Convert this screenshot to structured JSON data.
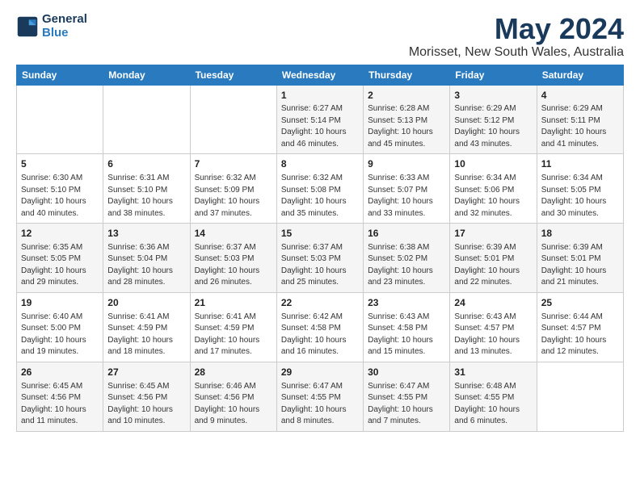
{
  "header": {
    "logo_line1": "General",
    "logo_line2": "Blue",
    "title": "May 2024",
    "subtitle": "Morisset, New South Wales, Australia"
  },
  "days_of_week": [
    "Sunday",
    "Monday",
    "Tuesday",
    "Wednesday",
    "Thursday",
    "Friday",
    "Saturday"
  ],
  "weeks": [
    [
      {
        "day": "",
        "sunrise": "",
        "sunset": "",
        "daylight": ""
      },
      {
        "day": "",
        "sunrise": "",
        "sunset": "",
        "daylight": ""
      },
      {
        "day": "",
        "sunrise": "",
        "sunset": "",
        "daylight": ""
      },
      {
        "day": "1",
        "sunrise": "Sunrise: 6:27 AM",
        "sunset": "Sunset: 5:14 PM",
        "daylight": "Daylight: 10 hours and 46 minutes."
      },
      {
        "day": "2",
        "sunrise": "Sunrise: 6:28 AM",
        "sunset": "Sunset: 5:13 PM",
        "daylight": "Daylight: 10 hours and 45 minutes."
      },
      {
        "day": "3",
        "sunrise": "Sunrise: 6:29 AM",
        "sunset": "Sunset: 5:12 PM",
        "daylight": "Daylight: 10 hours and 43 minutes."
      },
      {
        "day": "4",
        "sunrise": "Sunrise: 6:29 AM",
        "sunset": "Sunset: 5:11 PM",
        "daylight": "Daylight: 10 hours and 41 minutes."
      }
    ],
    [
      {
        "day": "5",
        "sunrise": "Sunrise: 6:30 AM",
        "sunset": "Sunset: 5:10 PM",
        "daylight": "Daylight: 10 hours and 40 minutes."
      },
      {
        "day": "6",
        "sunrise": "Sunrise: 6:31 AM",
        "sunset": "Sunset: 5:10 PM",
        "daylight": "Daylight: 10 hours and 38 minutes."
      },
      {
        "day": "7",
        "sunrise": "Sunrise: 6:32 AM",
        "sunset": "Sunset: 5:09 PM",
        "daylight": "Daylight: 10 hours and 37 minutes."
      },
      {
        "day": "8",
        "sunrise": "Sunrise: 6:32 AM",
        "sunset": "Sunset: 5:08 PM",
        "daylight": "Daylight: 10 hours and 35 minutes."
      },
      {
        "day": "9",
        "sunrise": "Sunrise: 6:33 AM",
        "sunset": "Sunset: 5:07 PM",
        "daylight": "Daylight: 10 hours and 33 minutes."
      },
      {
        "day": "10",
        "sunrise": "Sunrise: 6:34 AM",
        "sunset": "Sunset: 5:06 PM",
        "daylight": "Daylight: 10 hours and 32 minutes."
      },
      {
        "day": "11",
        "sunrise": "Sunrise: 6:34 AM",
        "sunset": "Sunset: 5:05 PM",
        "daylight": "Daylight: 10 hours and 30 minutes."
      }
    ],
    [
      {
        "day": "12",
        "sunrise": "Sunrise: 6:35 AM",
        "sunset": "Sunset: 5:05 PM",
        "daylight": "Daylight: 10 hours and 29 minutes."
      },
      {
        "day": "13",
        "sunrise": "Sunrise: 6:36 AM",
        "sunset": "Sunset: 5:04 PM",
        "daylight": "Daylight: 10 hours and 28 minutes."
      },
      {
        "day": "14",
        "sunrise": "Sunrise: 6:37 AM",
        "sunset": "Sunset: 5:03 PM",
        "daylight": "Daylight: 10 hours and 26 minutes."
      },
      {
        "day": "15",
        "sunrise": "Sunrise: 6:37 AM",
        "sunset": "Sunset: 5:03 PM",
        "daylight": "Daylight: 10 hours and 25 minutes."
      },
      {
        "day": "16",
        "sunrise": "Sunrise: 6:38 AM",
        "sunset": "Sunset: 5:02 PM",
        "daylight": "Daylight: 10 hours and 23 minutes."
      },
      {
        "day": "17",
        "sunrise": "Sunrise: 6:39 AM",
        "sunset": "Sunset: 5:01 PM",
        "daylight": "Daylight: 10 hours and 22 minutes."
      },
      {
        "day": "18",
        "sunrise": "Sunrise: 6:39 AM",
        "sunset": "Sunset: 5:01 PM",
        "daylight": "Daylight: 10 hours and 21 minutes."
      }
    ],
    [
      {
        "day": "19",
        "sunrise": "Sunrise: 6:40 AM",
        "sunset": "Sunset: 5:00 PM",
        "daylight": "Daylight: 10 hours and 19 minutes."
      },
      {
        "day": "20",
        "sunrise": "Sunrise: 6:41 AM",
        "sunset": "Sunset: 4:59 PM",
        "daylight": "Daylight: 10 hours and 18 minutes."
      },
      {
        "day": "21",
        "sunrise": "Sunrise: 6:41 AM",
        "sunset": "Sunset: 4:59 PM",
        "daylight": "Daylight: 10 hours and 17 minutes."
      },
      {
        "day": "22",
        "sunrise": "Sunrise: 6:42 AM",
        "sunset": "Sunset: 4:58 PM",
        "daylight": "Daylight: 10 hours and 16 minutes."
      },
      {
        "day": "23",
        "sunrise": "Sunrise: 6:43 AM",
        "sunset": "Sunset: 4:58 PM",
        "daylight": "Daylight: 10 hours and 15 minutes."
      },
      {
        "day": "24",
        "sunrise": "Sunrise: 6:43 AM",
        "sunset": "Sunset: 4:57 PM",
        "daylight": "Daylight: 10 hours and 13 minutes."
      },
      {
        "day": "25",
        "sunrise": "Sunrise: 6:44 AM",
        "sunset": "Sunset: 4:57 PM",
        "daylight": "Daylight: 10 hours and 12 minutes."
      }
    ],
    [
      {
        "day": "26",
        "sunrise": "Sunrise: 6:45 AM",
        "sunset": "Sunset: 4:56 PM",
        "daylight": "Daylight: 10 hours and 11 minutes."
      },
      {
        "day": "27",
        "sunrise": "Sunrise: 6:45 AM",
        "sunset": "Sunset: 4:56 PM",
        "daylight": "Daylight: 10 hours and 10 minutes."
      },
      {
        "day": "28",
        "sunrise": "Sunrise: 6:46 AM",
        "sunset": "Sunset: 4:56 PM",
        "daylight": "Daylight: 10 hours and 9 minutes."
      },
      {
        "day": "29",
        "sunrise": "Sunrise: 6:47 AM",
        "sunset": "Sunset: 4:55 PM",
        "daylight": "Daylight: 10 hours and 8 minutes."
      },
      {
        "day": "30",
        "sunrise": "Sunrise: 6:47 AM",
        "sunset": "Sunset: 4:55 PM",
        "daylight": "Daylight: 10 hours and 7 minutes."
      },
      {
        "day": "31",
        "sunrise": "Sunrise: 6:48 AM",
        "sunset": "Sunset: 4:55 PM",
        "daylight": "Daylight: 10 hours and 6 minutes."
      },
      {
        "day": "",
        "sunrise": "",
        "sunset": "",
        "daylight": ""
      }
    ]
  ]
}
